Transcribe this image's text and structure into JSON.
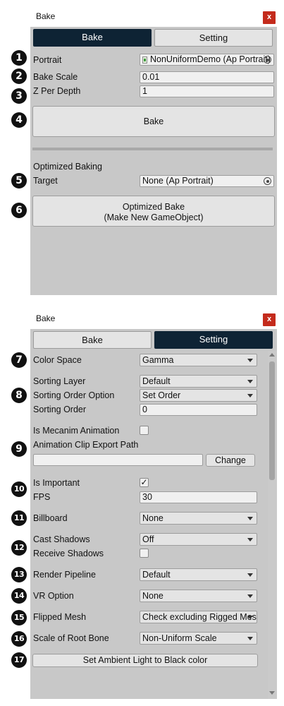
{
  "window1": {
    "title": "Bake",
    "close_label": "x",
    "tabs": [
      {
        "label": "Bake",
        "active": true
      },
      {
        "label": "Setting",
        "active": false
      }
    ],
    "badges": [
      "1",
      "2",
      "3",
      "4",
      "5",
      "6"
    ],
    "portrait_label": "Portrait",
    "portrait_value": "NonUniformDemo (Ap Portrait)",
    "bake_scale_label": "Bake Scale",
    "bake_scale_value": "0.01",
    "z_per_depth_label": "Z Per Depth",
    "z_per_depth_value": "1",
    "bake_button": "Bake",
    "optimized_section": "Optimized Baking",
    "target_label": "Target",
    "target_value": "None (Ap Portrait)",
    "optimized_button_line1": "Optimized Bake",
    "optimized_button_line2": "(Make New GameObject)"
  },
  "window2": {
    "title": "Bake",
    "close_label": "x",
    "tabs": [
      {
        "label": "Bake",
        "active": false
      },
      {
        "label": "Setting",
        "active": true
      }
    ],
    "badges": [
      "7",
      "8",
      "9",
      "10",
      "11",
      "12",
      "13",
      "14",
      "15",
      "16",
      "17"
    ],
    "color_space_label": "Color Space",
    "color_space_value": "Gamma",
    "sorting_layer_label": "Sorting Layer",
    "sorting_layer_value": "Default",
    "sorting_order_option_label": "Sorting Order Option",
    "sorting_order_option_value": "Set Order",
    "sorting_order_label": "Sorting Order",
    "sorting_order_value": "0",
    "mecanim_label": "Is Mecanim Animation",
    "mecanim_checked": false,
    "anim_export_label": "Animation Clip Export Path",
    "anim_export_value": "",
    "change_button": "Change",
    "is_important_label": "Is Important",
    "is_important_checked": true,
    "checkmark": "✓",
    "fps_label": "FPS",
    "fps_value": "30",
    "billboard_label": "Billboard",
    "billboard_value": "None",
    "cast_shadows_label": "Cast Shadows",
    "cast_shadows_value": "Off",
    "receive_shadows_label": "Receive Shadows",
    "receive_shadows_checked": false,
    "render_pipeline_label": "Render Pipeline",
    "render_pipeline_value": "Default",
    "vr_option_label": "VR Option",
    "vr_option_value": "None",
    "flipped_mesh_label": "Flipped Mesh",
    "flipped_mesh_value": "Check excluding Rigged Mesh",
    "scale_root_label": "Scale of Root Bone",
    "scale_root_value": "Non-Uniform Scale",
    "ambient_button": "Set Ambient Light to Black color"
  },
  "colors": {
    "active_tab": "#0e2334",
    "close_button": "#c42b1c",
    "panel": "#c8c8c8"
  }
}
